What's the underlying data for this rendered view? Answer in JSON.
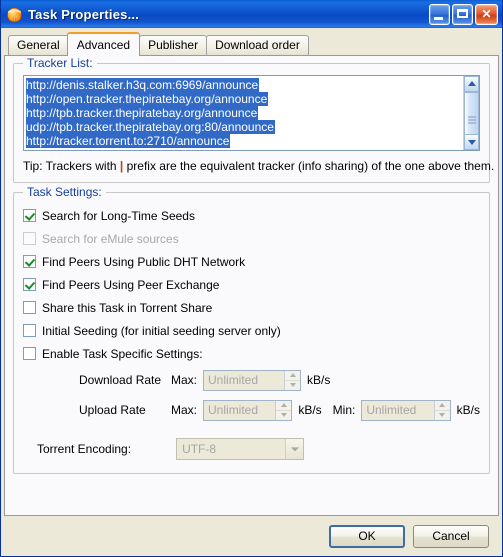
{
  "window": {
    "title": "Task Properties...",
    "icon": "bitcomet-globe-icon",
    "minimize_label": "Minimize",
    "maximize_label": "Maximize",
    "close_label": "Close"
  },
  "tabs": [
    {
      "label": "General",
      "active": false
    },
    {
      "label": "Advanced",
      "active": true
    },
    {
      "label": "Publisher",
      "active": false
    },
    {
      "label": "Download order",
      "active": false
    }
  ],
  "tracker_group": {
    "title": "Tracker List:",
    "trackers": [
      "http://denis.stalker.h3q.com:6969/announce",
      "http://open.tracker.thepiratebay.org/announce",
      "http://tpb.tracker.thepiratebay.org/announce",
      "udp://tpb.tracker.thepiratebay.org:80/announce",
      "http://tracker.torrent.to:2710/announce"
    ],
    "tip_prefix": "Tip: Trackers with ",
    "tip_pipe": "|",
    "tip_suffix": " prefix are the equivalent tracker (info sharing) of the one above them."
  },
  "task_settings": {
    "title": "Task Settings:",
    "checkboxes": [
      {
        "label": "Search for Long-Time Seeds",
        "checked": true,
        "enabled": true
      },
      {
        "label": "Search for eMule sources",
        "checked": false,
        "enabled": false
      },
      {
        "label": "Find Peers Using Public DHT Network",
        "checked": true,
        "enabled": true
      },
      {
        "label": "Find Peers Using Peer Exchange",
        "checked": true,
        "enabled": true
      },
      {
        "label": "Share this Task in Torrent Share",
        "checked": false,
        "enabled": true
      },
      {
        "label": "Initial Seeding (for initial seeding server only)",
        "checked": false,
        "enabled": true
      },
      {
        "label": "Enable Task Specific Settings:",
        "checked": false,
        "enabled": true
      }
    ],
    "download_rate": {
      "name": "Download Rate",
      "max_label": "Max:",
      "max_value": "Unlimited",
      "max_unit": "kB/s"
    },
    "upload_rate": {
      "name": "Upload Rate",
      "max_label": "Max:",
      "max_value": "Unlimited",
      "max_unit": "kB/s",
      "min_label": "Min:",
      "min_value": "Unlimited",
      "min_unit": "kB/s"
    },
    "encoding": {
      "label": "Torrent Encoding:",
      "value": "UTF-8"
    }
  },
  "buttons": {
    "ok": "OK",
    "cancel": "Cancel"
  },
  "colors": {
    "titlebar_blue": "#0b49c4",
    "active_tab_accent": "#f0a026",
    "group_title_blue": "#15409b",
    "selection_blue": "#3169c6",
    "checkmark_green": "#1a8a27",
    "dialog_face": "#ece9d8",
    "panel_white": "#fafafc",
    "tip_pipe_red": "#c04000"
  }
}
